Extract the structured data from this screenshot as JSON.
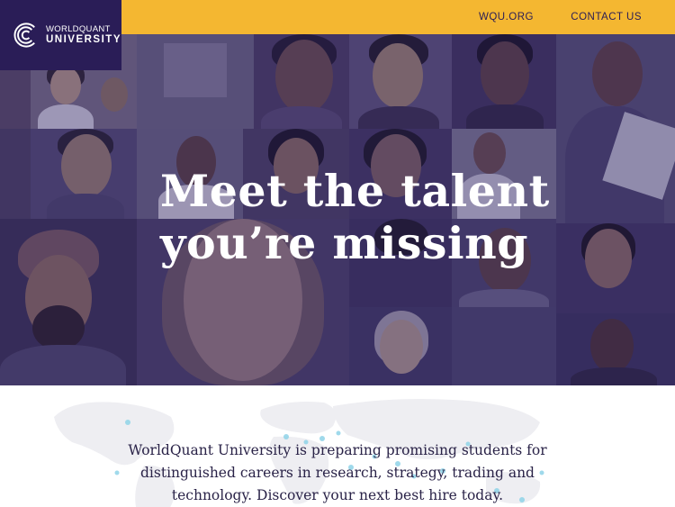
{
  "header": {
    "logo": {
      "line1": "WORLDQUANT",
      "line2": "UNIVERSITY",
      "icon": "wqu-concentric-c-logo"
    },
    "nav": [
      {
        "label": "WQU.ORG"
      },
      {
        "label": "CONTACT US"
      }
    ],
    "colors": {
      "bar": "#f4b731",
      "logo_bg": "#2a1d57",
      "nav_text": "#2a1d57"
    }
  },
  "hero": {
    "title_line1": "Meet the talent",
    "title_line2": "you’re missing",
    "overlay_color": "#30245c"
  },
  "intro": {
    "text": "WorldQuant University is preparing promising students for distinguished careers in research, strategy, trading and technology. Discover your next best hire today."
  },
  "map": {
    "icon": "world-map-graphic",
    "dot_color": "#8fd3e8"
  }
}
